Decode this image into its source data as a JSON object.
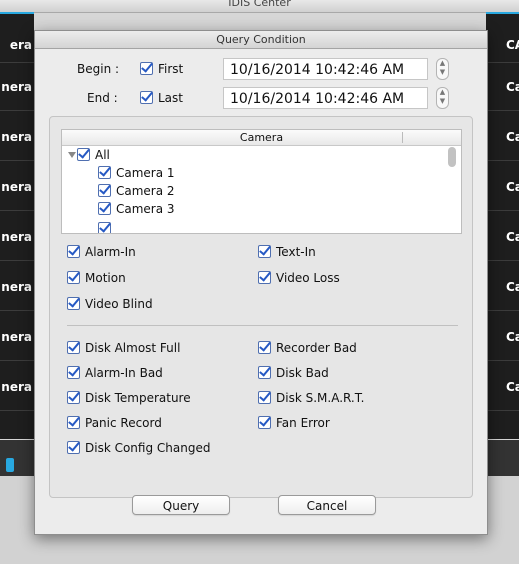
{
  "app": {
    "title": "IDIS Center"
  },
  "background": {
    "left_cells": [
      "era",
      "nera",
      "nera",
      "nera",
      "nera",
      "nera",
      "nera",
      "nera"
    ],
    "right_cells": [
      "CA",
      "Ca",
      "Ca",
      "Ca",
      "Ca",
      "Ca",
      "Ca",
      "Ca"
    ]
  },
  "dialog": {
    "title": "Query Condition",
    "begin": {
      "label": "Begin :",
      "check_label": "First",
      "value": "10/16/2014 10:42:46 AM"
    },
    "end": {
      "label": "End :",
      "check_label": "Last",
      "value": "10/16/2014 10:42:46 AM"
    },
    "camera_list": {
      "header": "Camera",
      "all_label": "All",
      "items": [
        "Camera 1",
        "Camera 2",
        "Camera 3"
      ]
    },
    "event_options": {
      "left": [
        "Alarm-In",
        "Motion",
        "Video Blind"
      ],
      "right": [
        "Text-In",
        "Video Loss"
      ]
    },
    "system_options": {
      "left": [
        "Disk Almost Full",
        "Alarm-In Bad",
        "Disk Temperature",
        "Panic Record",
        "Disk Config Changed"
      ],
      "right": [
        "Recorder Bad",
        "Disk Bad",
        "Disk S.M.A.R.T.",
        "Fan Error"
      ]
    },
    "buttons": {
      "query": "Query",
      "cancel": "Cancel"
    }
  },
  "colors": {
    "check_accent": "#2659c4",
    "dark_panel": "#1e1e1e"
  }
}
